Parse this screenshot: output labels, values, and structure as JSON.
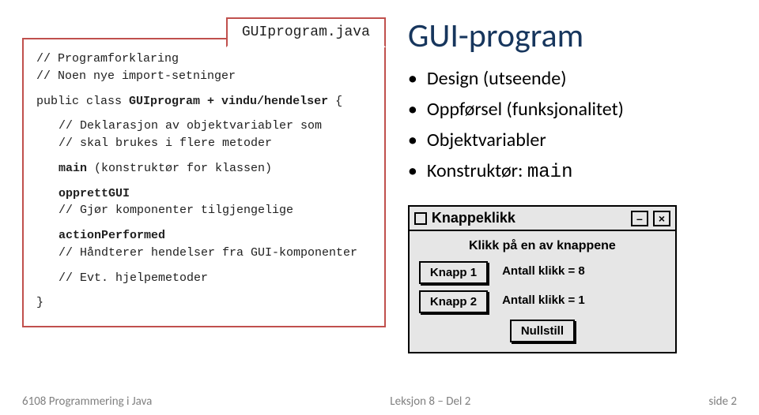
{
  "code": {
    "filename": "GUIprogram.java",
    "c1": "// Programforklaring",
    "c2": "// Noen nye import-setninger",
    "classline_pre": "public class ",
    "classline_name": "GUIprogram + vindu/hendelser",
    "classline_post": " {",
    "c3": "// Deklarasjon av objektvariabler som",
    "c4": "// skal brukes i flere metoder",
    "main_kw": "main",
    "main_rest": "  (konstruktør for klassen)",
    "g1": "opprettGUI",
    "g2": "// Gjør komponenter tilgjengelige",
    "a1": "actionPerformed",
    "a2": "// Håndterer hendelser fra GUI-komponenter",
    "h1": "// Evt. hjelpemetoder",
    "close": "}"
  },
  "title": "GUI-program",
  "bullets": {
    "b1": "Design (utseende)",
    "b2": "Oppførsel (funksjonalitet)",
    "b3": "Objektvariabler",
    "b4_pre": "Konstruktør: ",
    "b4_mono": "main"
  },
  "mock": {
    "title": "Knappeklikk",
    "minimize": "–",
    "close": "×",
    "prompt": "Klikk på en av knappene",
    "btn1": "Knapp 1",
    "lbl1": "Antall klikk = 8",
    "btn2": "Knapp 2",
    "lbl2": "Antall klikk = 1",
    "reset": "Nullstill"
  },
  "footer": {
    "left": "6108 Programmering i Java",
    "center": "Leksjon 8 – Del 2",
    "right": "side 2"
  }
}
